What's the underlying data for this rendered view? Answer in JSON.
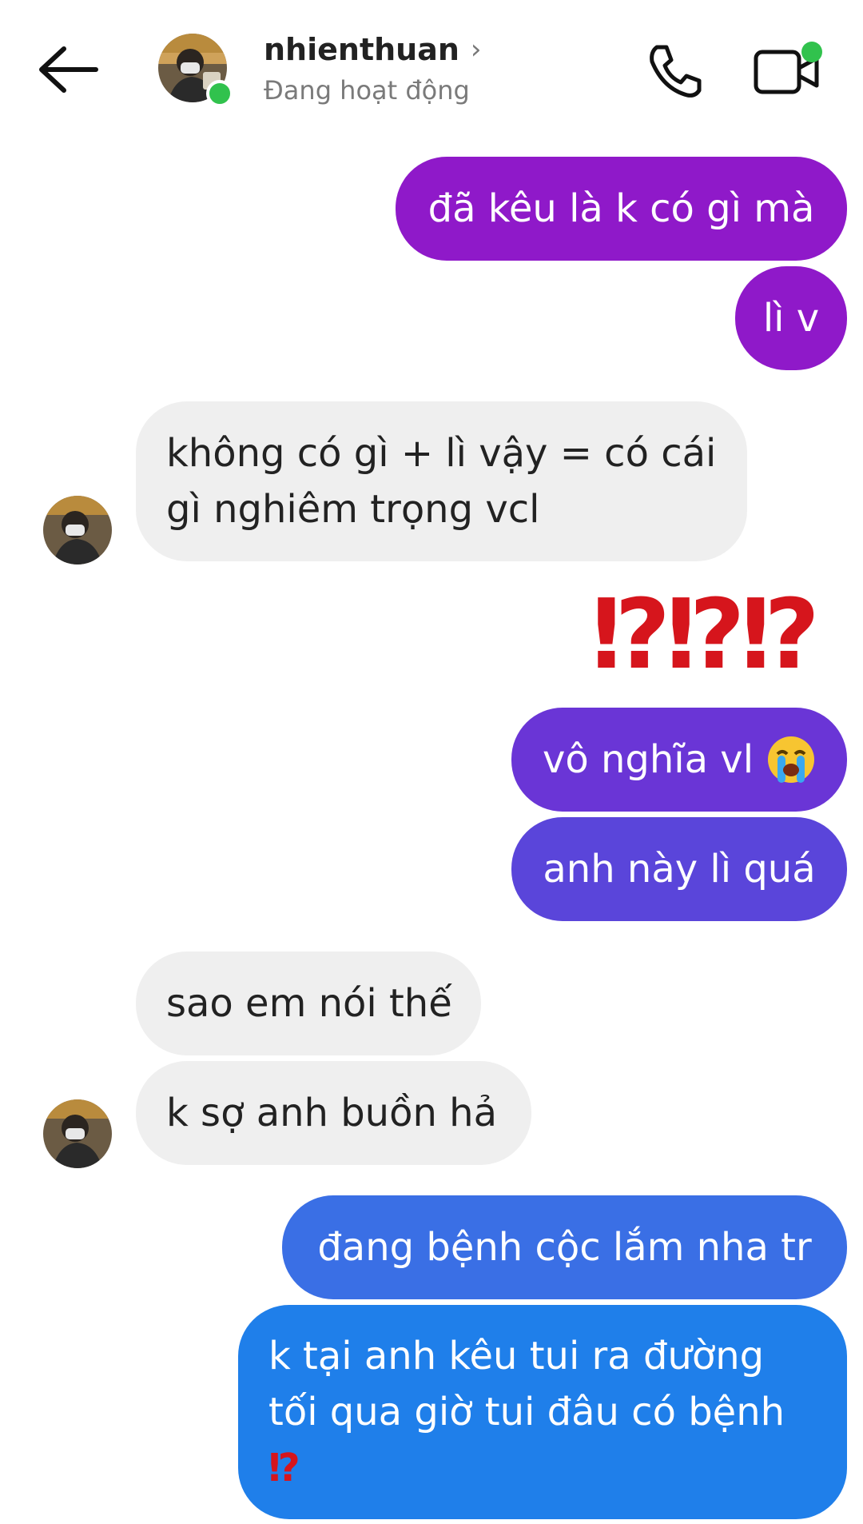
{
  "header": {
    "contact_name": "nhienthuan",
    "status": "Đang hoạt động"
  },
  "colors": {
    "bubble_purple": "#8f19c9",
    "bubble_violet": "#6a35d6",
    "bubble_indigo": "#5a45da",
    "bubble_blue": "#3a6fe5",
    "bubble_blue2": "#1f7fea",
    "bubble_incoming": "#efefef",
    "online_green": "#31c24d",
    "interrobang_red": "#d6151c"
  },
  "messages": [
    {
      "side": "out",
      "text": "đã kêu là k có gì mà"
    },
    {
      "side": "out",
      "text": "lì v"
    },
    {
      "side": "in",
      "line1": "không có gì + lì vậy = có cái",
      "line2": "gì nghiêm trọng vcl"
    },
    {
      "side": "out",
      "text": "⁉⁉⁉"
    },
    {
      "side": "out",
      "text": "vô nghĩa vl",
      "emoji": "loudly-crying-face"
    },
    {
      "side": "out",
      "text": "anh này lì quá"
    },
    {
      "side": "in",
      "text": "sao em nói thế"
    },
    {
      "side": "in",
      "text": "k sợ anh buồn hả"
    },
    {
      "side": "out",
      "text": "đang bệnh cộc lắm nha tr"
    },
    {
      "side": "out",
      "line1": "k tại anh kêu tui ra đường",
      "line2": "tối qua giờ tui đâu có bệnh",
      "line3": "⁉"
    }
  ]
}
